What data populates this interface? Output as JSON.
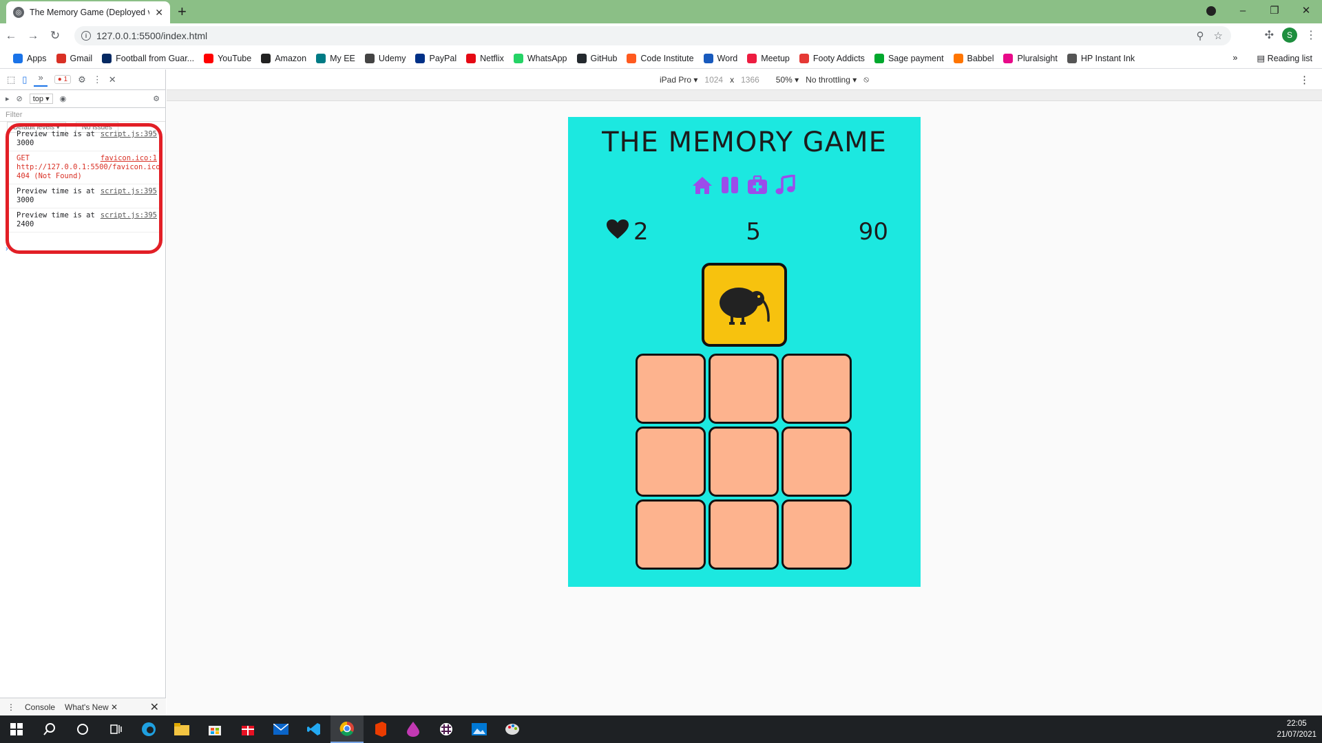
{
  "browser": {
    "tab_title": "The Memory Game (Deployed ve",
    "tab_close": "✕",
    "new_tab": "+",
    "url": "127.0.0.1:5500/index.html",
    "profile_initial": "S",
    "window_controls": [
      "–",
      "❐",
      "✕"
    ]
  },
  "bookmarks": {
    "items": [
      {
        "label": "Apps",
        "icon": "apps-grid-icon",
        "color": "#1a73e8"
      },
      {
        "label": "Gmail",
        "icon": "gmail-icon",
        "color": "#d93025"
      },
      {
        "label": "Football from Guar...",
        "icon": "guardian-icon",
        "color": "#052962"
      },
      {
        "label": "YouTube",
        "icon": "youtube-icon",
        "color": "#ff0000"
      },
      {
        "label": "Amazon",
        "icon": "amazon-icon",
        "color": "#222222"
      },
      {
        "label": "My EE",
        "icon": "ee-icon",
        "color": "#007b85"
      },
      {
        "label": "Udemy",
        "icon": "udemy-icon",
        "color": "#444444"
      },
      {
        "label": "PayPal",
        "icon": "paypal-icon",
        "color": "#003087"
      },
      {
        "label": "Netflix",
        "icon": "netflix-icon",
        "color": "#e50914"
      },
      {
        "label": "WhatsApp",
        "icon": "whatsapp-icon",
        "color": "#25d366"
      },
      {
        "label": "GitHub",
        "icon": "github-icon",
        "color": "#24292e"
      },
      {
        "label": "Code Institute",
        "icon": "code-institute-icon",
        "color": "#ff5a1f"
      },
      {
        "label": "Word",
        "icon": "word-icon",
        "color": "#185abd"
      },
      {
        "label": "Meetup",
        "icon": "meetup-icon",
        "color": "#ed1c40"
      },
      {
        "label": "Footy Addicts",
        "icon": "footy-addicts-icon",
        "color": "#e53935"
      },
      {
        "label": "Sage payment",
        "icon": "sage-icon",
        "color": "#00a82d"
      },
      {
        "label": "Babbel",
        "icon": "babbel-icon",
        "color": "#ff7500"
      },
      {
        "label": "Pluralsight",
        "icon": "pluralsight-icon",
        "color": "#e80a89"
      },
      {
        "label": "HP Instant Ink",
        "icon": "hp-icon",
        "color": "#555555"
      }
    ],
    "overflow": "»",
    "reading_list": "Reading list"
  },
  "devtools": {
    "overflow": "»",
    "error_count": "1",
    "context": "top ▾",
    "filter_placeholder": "Filter",
    "default_levels": "Default levels ▾",
    "issues": "No issues",
    "logs": [
      {
        "text": "Preview time is at 3000",
        "source": "script.js:395",
        "error": false
      },
      {
        "text": "GET http://127.0.0.1:5500/favicon.ico 404 (Not Found)",
        "source": "favicon.ico:1",
        "error": true
      },
      {
        "text": "Preview time is at 3000",
        "source": "script.js:395",
        "error": false
      },
      {
        "text": "Preview time is at 2400",
        "source": "script.js:395",
        "error": false
      }
    ],
    "prompt": "›",
    "drawer_tabs": [
      "Console",
      "What's New ✕"
    ],
    "drawer_close": "✕"
  },
  "device_toolbar": {
    "device": "iPad Pro ▾",
    "width": "1024",
    "times": "x",
    "height": "1366",
    "zoom": "50% ▾",
    "throttling": "No throttling ▾",
    "more": "⋮"
  },
  "game": {
    "title": "THE MEMORY GAME",
    "lives": "2",
    "level": "5",
    "score": "90",
    "preview_card": "kiwi-bird",
    "cards": 9,
    "colors": {
      "background": "#1ce8e0",
      "card_back": "#fdb38e",
      "preview_card": "#f7c20e",
      "icons": "#9b4dea"
    }
  },
  "taskbar": {
    "time": "22:05",
    "date": "21/07/2021"
  }
}
